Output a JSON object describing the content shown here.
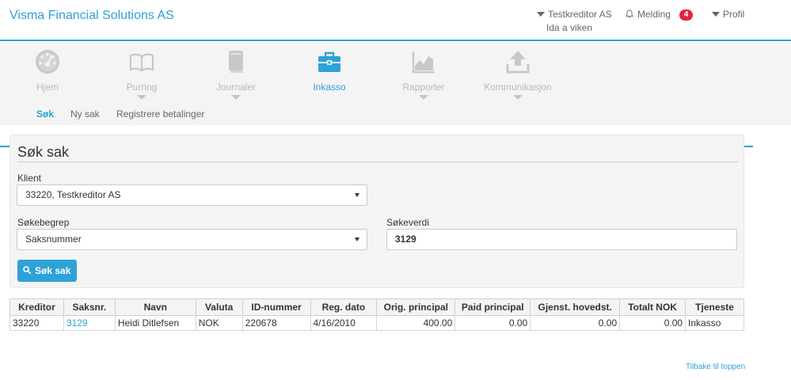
{
  "header": {
    "company": "Visma Financial Solutions AS",
    "creditor": "Testkreditor AS",
    "creditor_user": "Ida a viken",
    "notifications_label": "Melding",
    "notifications_count": "4",
    "profile_label": "Profil"
  },
  "modules": [
    {
      "label": "Hjem",
      "icon": "dashboard-gauge-icon"
    },
    {
      "label": "Purring",
      "icon": "open-book-icon"
    },
    {
      "label": "Journaler",
      "icon": "journal-book-icon"
    },
    {
      "label": "Inkasso",
      "icon": "briefcase-icon"
    },
    {
      "label": "Rapporter",
      "icon": "area-chart-icon"
    },
    {
      "label": "Kommunikasjon",
      "icon": "upload-icon"
    }
  ],
  "subtabs": [
    "Søk",
    "Ny sak",
    "Registrere betalinger"
  ],
  "search": {
    "title": "Søk sak",
    "client_label": "Klient",
    "client_value": "33220, Testkreditor AS",
    "term_label": "Søkebegrep",
    "term_value": "Saksnummer",
    "value_label": "Søkeverdi",
    "value_value": "3129",
    "button": "Søk sak"
  },
  "table": {
    "headers": [
      "Kreditor",
      "Saksnr.",
      "Navn",
      "Valuta",
      "ID-nummer",
      "Reg. dato",
      "Orig. principal",
      "Paid principal",
      "Gjenst. hovedst.",
      "Totalt NOK",
      "Tjeneste"
    ],
    "rows": [
      [
        "33220",
        "3129",
        "Heidi Ditlefsen",
        "NOK",
        "220678",
        "4/16/2010",
        "400.00",
        "0.00",
        "0.00",
        "0.00",
        "Inkasso"
      ]
    ]
  },
  "footer": {
    "back_to_top": "Tilbake til toppen"
  },
  "colors": {
    "accent": "#2ea1d8",
    "badge": "#e0253f",
    "icon_inactive": "#c8c8c8"
  }
}
